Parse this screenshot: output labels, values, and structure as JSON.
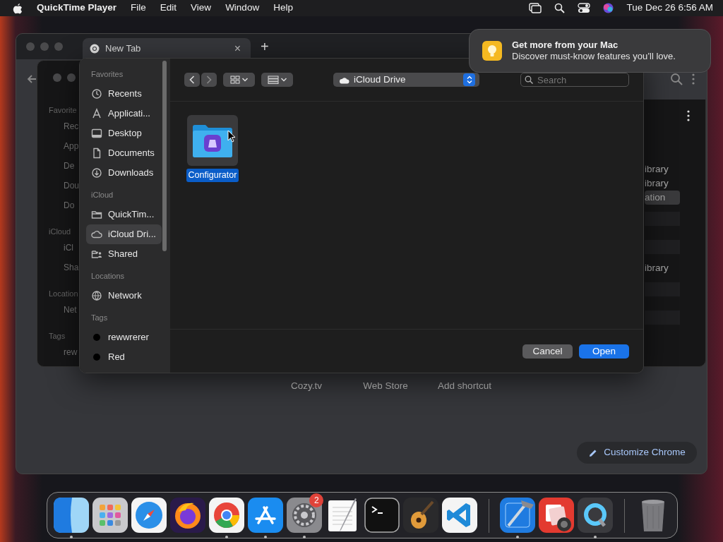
{
  "menubar": {
    "app": "QuickTime Player",
    "menus": [
      "File",
      "Edit",
      "View",
      "Window",
      "Help"
    ],
    "clock": "Tue Dec 26  6:56 AM"
  },
  "browser": {
    "tabs": [
      {
        "label": "New Tab",
        "selected": true,
        "close": "×"
      }
    ],
    "new_tab": "+",
    "shortcuts": [
      "Cozy.tv",
      "Web Store",
      "Add shortcut"
    ],
    "customize_button": "Customize Chrome"
  },
  "back_dialog": {
    "sidebar": [
      {
        "kind": "header",
        "label": "Favorite"
      },
      {
        "kind": "item",
        "label": "Rec"
      },
      {
        "kind": "item",
        "label": "App"
      },
      {
        "kind": "item",
        "label": "De"
      },
      {
        "kind": "item",
        "label": "Dou"
      },
      {
        "kind": "item",
        "label": "Do"
      },
      {
        "kind": "header",
        "label": "iCloud"
      },
      {
        "kind": "item",
        "label": "iCl"
      },
      {
        "kind": "item",
        "label": "Sha"
      },
      {
        "kind": "header",
        "label": "Location"
      },
      {
        "kind": "item",
        "label": "Net"
      },
      {
        "kind": "header",
        "label": "Tags"
      },
      {
        "kind": "item",
        "label": "rew"
      }
    ],
    "rows": [
      {
        "kind": "text",
        "label": "ibrary",
        "selected": false
      },
      {
        "kind": "text",
        "label": "ibrary",
        "selected": false
      },
      {
        "kind": "text",
        "label": "ation",
        "selected": true
      },
      {
        "kind": "blank"
      },
      {
        "kind": "blank"
      },
      {
        "kind": "text",
        "label": "ibrary",
        "selected": false
      },
      {
        "kind": "blank"
      },
      {
        "kind": "blank"
      }
    ]
  },
  "dialog": {
    "sidebar": [
      {
        "kind": "header",
        "label": "Favorites"
      },
      {
        "kind": "item",
        "label": "Recents",
        "selected": false
      },
      {
        "kind": "item",
        "label": "Applicati...",
        "selected": false
      },
      {
        "kind": "item",
        "label": "Desktop",
        "selected": false
      },
      {
        "kind": "item",
        "label": "Documents",
        "selected": false
      },
      {
        "kind": "item",
        "label": "Downloads",
        "selected": false
      },
      {
        "kind": "header",
        "label": "iCloud"
      },
      {
        "kind": "item",
        "label": "QuickTim...",
        "selected": false
      },
      {
        "kind": "item",
        "label": "iCloud Dri...",
        "selected": true
      },
      {
        "kind": "item",
        "label": "Shared",
        "selected": false
      },
      {
        "kind": "header",
        "label": "Locations"
      },
      {
        "kind": "item",
        "label": "Network",
        "selected": false
      },
      {
        "kind": "header",
        "label": "Tags"
      },
      {
        "kind": "tag",
        "label": "rewwrerer",
        "color": "#000000"
      },
      {
        "kind": "tag",
        "label": "Red",
        "color": "#000000"
      }
    ],
    "location": "iCloud Drive",
    "search": {
      "placeholder": "Search"
    },
    "files": [
      {
        "name": "Configurator",
        "selected": true
      }
    ],
    "buttons": [
      {
        "label": "Cancel",
        "kind": "secondary"
      },
      {
        "label": "Open",
        "kind": "primary"
      }
    ]
  },
  "notification": {
    "title": "Get more from your Mac",
    "body": "Discover must-know features you’ll love."
  },
  "dock": {
    "apps": [
      {
        "kind": "finder",
        "running": true
      },
      {
        "kind": "launchpad",
        "running": false
      },
      {
        "kind": "safari",
        "running": false
      },
      {
        "kind": "firefox",
        "running": false
      },
      {
        "kind": "chrome",
        "running": true
      },
      {
        "kind": "appstore",
        "running": true
      },
      {
        "kind": "settings",
        "running": true,
        "badge": "2"
      },
      {
        "kind": "textedit",
        "running": false
      },
      {
        "kind": "terminal",
        "running": false
      },
      {
        "kind": "garageband",
        "running": false
      },
      {
        "kind": "vscode",
        "running": false
      },
      {
        "kind": "separator"
      },
      {
        "kind": "xcode",
        "running": true
      },
      {
        "kind": "photobooth",
        "running": false
      },
      {
        "kind": "quicktime",
        "running": true
      },
      {
        "kind": "separator"
      },
      {
        "kind": "trash",
        "running": false
      }
    ]
  }
}
